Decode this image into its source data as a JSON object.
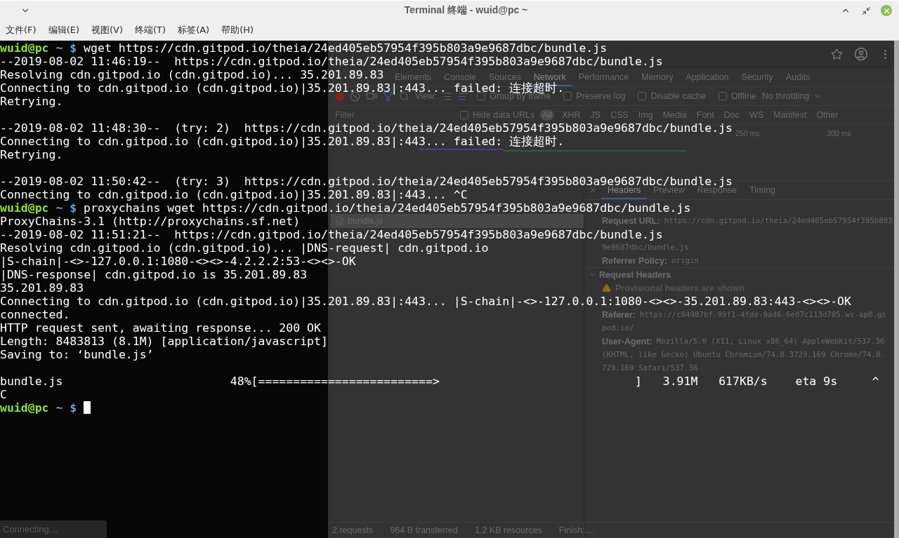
{
  "window": {
    "title": "Terminal 终端 - wuid@pc ~"
  },
  "menu": [
    {
      "label": "文件(F)"
    },
    {
      "label": "编辑(E)"
    },
    {
      "label": "视图(V)"
    },
    {
      "label": "终端(T)"
    },
    {
      "label": "标签(A)"
    },
    {
      "label": "帮助(H)"
    }
  ],
  "terminal": {
    "lines": [
      {
        "kind": "prompt",
        "user": "wuid@pc",
        "dir": "~",
        "symbol": "$",
        "command": "wget https://cdn.gitpod.io/theia/24ed405eb57954f395b803a9e9687dbc/bundle.js"
      },
      {
        "kind": "output",
        "text": "--2019-08-02 11:46:19--  https://cdn.gitpod.io/theia/24ed405eb57954f395b803a9e9687dbc/bundle.js"
      },
      {
        "kind": "output",
        "text": "Resolving cdn.gitpod.io (cdn.gitpod.io)... 35.201.89.83"
      },
      {
        "kind": "output",
        "text": "Connecting to cdn.gitpod.io (cdn.gitpod.io)|35.201.89.83|:443... failed: 连接超时."
      },
      {
        "kind": "output",
        "text": "Retrying."
      },
      {
        "kind": "blank"
      },
      {
        "kind": "output",
        "text": "--2019-08-02 11:48:30--  (try: 2)  https://cdn.gitpod.io/theia/24ed405eb57954f395b803a9e9687dbc/bundle.js"
      },
      {
        "kind": "output",
        "text": "Connecting to cdn.gitpod.io (cdn.gitpod.io)|35.201.89.83|:443... failed: 连接超时."
      },
      {
        "kind": "output",
        "text": "Retrying."
      },
      {
        "kind": "blank"
      },
      {
        "kind": "output",
        "text": "--2019-08-02 11:50:42--  (try: 3)  https://cdn.gitpod.io/theia/24ed405eb57954f395b803a9e9687dbc/bundle.js"
      },
      {
        "kind": "output",
        "text": "Connecting to cdn.gitpod.io (cdn.gitpod.io)|35.201.89.83|:443... ^C"
      },
      {
        "kind": "prompt",
        "user": "wuid@pc",
        "dir": "~",
        "symbol": "$",
        "command": "proxychains wget https://cdn.gitpod.io/theia/24ed405eb57954f395b803a9e9687dbc/bundle.js"
      },
      {
        "kind": "output",
        "text": "ProxyChains-3.1 (http://proxychains.sf.net)"
      },
      {
        "kind": "output",
        "text": "--2019-08-02 11:51:21--  https://cdn.gitpod.io/theia/24ed405eb57954f395b803a9e9687dbc/bundle.js"
      },
      {
        "kind": "output",
        "text": "Resolving cdn.gitpod.io (cdn.gitpod.io)... |DNS-request| cdn.gitpod.io"
      },
      {
        "kind": "output",
        "text": "|S-chain|-<>-127.0.0.1:1080-<><>-4.2.2.2:53-<><>-OK"
      },
      {
        "kind": "output",
        "text": "|DNS-response| cdn.gitpod.io is 35.201.89.83"
      },
      {
        "kind": "output",
        "text": "35.201.89.83"
      },
      {
        "kind": "output",
        "text": "Connecting to cdn.gitpod.io (cdn.gitpod.io)|35.201.89.83|:443... |S-chain|-<>-127.0.0.1:1080-<><>-35.201.89.83:443-<><>-OK"
      },
      {
        "kind": "output",
        "text": "connected."
      },
      {
        "kind": "output",
        "text": "HTTP request sent, awaiting response... 200 OK"
      },
      {
        "kind": "output",
        "text": "Length: 8483813 (8.1M) [application/javascript]"
      },
      {
        "kind": "output",
        "text": "Saving to: ‘bundle.js’"
      },
      {
        "kind": "blank"
      },
      {
        "kind": "output",
        "text": "bundle.js                        48%[=========================>                            ]   3.91M   617KB/s    eta 9s     ^"
      },
      {
        "kind": "output",
        "text": "C"
      },
      {
        "kind": "prompt",
        "user": "wuid@pc",
        "dir": "~",
        "symbol": "$",
        "cursor": true
      }
    ]
  },
  "devtools": {
    "tabs": [
      {
        "label": "Elements",
        "selected": false
      },
      {
        "label": "Console",
        "selected": false
      },
      {
        "label": "Sources",
        "selected": false
      },
      {
        "label": "Network",
        "selected": true
      },
      {
        "label": "Performance",
        "selected": false
      },
      {
        "label": "Memory",
        "selected": false
      },
      {
        "label": "Application",
        "selected": false
      },
      {
        "label": "Security",
        "selected": false
      },
      {
        "label": "Audits",
        "selected": false
      }
    ],
    "toolbar": {
      "recording": true,
      "view_label": "View:",
      "options": [
        {
          "label": "Group by frame",
          "checked": false
        },
        {
          "label": "Preserve log",
          "checked": false
        },
        {
          "label": "Disable cache",
          "checked": false
        },
        {
          "label": "Offline",
          "checked": false
        }
      ],
      "throttling": "No throttling"
    },
    "filter": {
      "placeholder": "Filter",
      "hide_data_urls": {
        "label": "Hide data URLs",
        "checked": false
      },
      "types": [
        {
          "label": "All",
          "selected": true
        },
        {
          "label": "XHR",
          "selected": false
        },
        {
          "label": "JS",
          "selected": false
        },
        {
          "label": "CSS",
          "selected": false
        },
        {
          "label": "Img",
          "selected": false
        },
        {
          "label": "Media",
          "selected": false
        },
        {
          "label": "Font",
          "selected": false
        },
        {
          "label": "Doc",
          "selected": false
        },
        {
          "label": "WS",
          "selected": false
        },
        {
          "label": "Manifest",
          "selected": false
        },
        {
          "label": "Other",
          "selected": false
        }
      ]
    },
    "timeline": {
      "ticks": [
        "250 ms",
        "300 ms"
      ]
    },
    "requests": [
      {
        "name": "bundle.js",
        "selected": true
      }
    ],
    "detail_tabs": [
      {
        "label": "Headers",
        "selected": true
      },
      {
        "label": "Preview",
        "selected": false
      },
      {
        "label": "Response",
        "selected": false
      },
      {
        "label": "Timing",
        "selected": false
      }
    ],
    "general": [
      {
        "label": "Request URL:",
        "lines": [
          "https://cdn.gitpod.io/theia/24ed405eb57954f395b803",
          "9e9687dbc/bundle.js"
        ]
      },
      {
        "label": "Referrer Policy:",
        "lines": [
          "origin"
        ]
      }
    ],
    "request_headers": {
      "title": "Request Headers",
      "expanded": true,
      "warning": "Provisional headers are shown",
      "items": [
        {
          "label": "Referer:",
          "lines": [
            "https://c84987bf-99f1-4fde-9ad6-6e07c113d785.ws-ap0.gi",
            "pod.io/"
          ]
        },
        {
          "label": "User-Agent:",
          "lines": [
            "Mozilla/5.0 (X11; Linux x86_64) AppleWebKit/537.36",
            "(KHTML, like Gecko) Ubuntu Chromium/74.0.3729.169 Chrome/74.0.",
            "729.169 Safari/537.36"
          ]
        }
      ]
    },
    "status": [
      "2 requests",
      "964 B transferred",
      "1.2 KB resources",
      "Finish:…"
    ]
  },
  "browser_status": "Connecting…"
}
